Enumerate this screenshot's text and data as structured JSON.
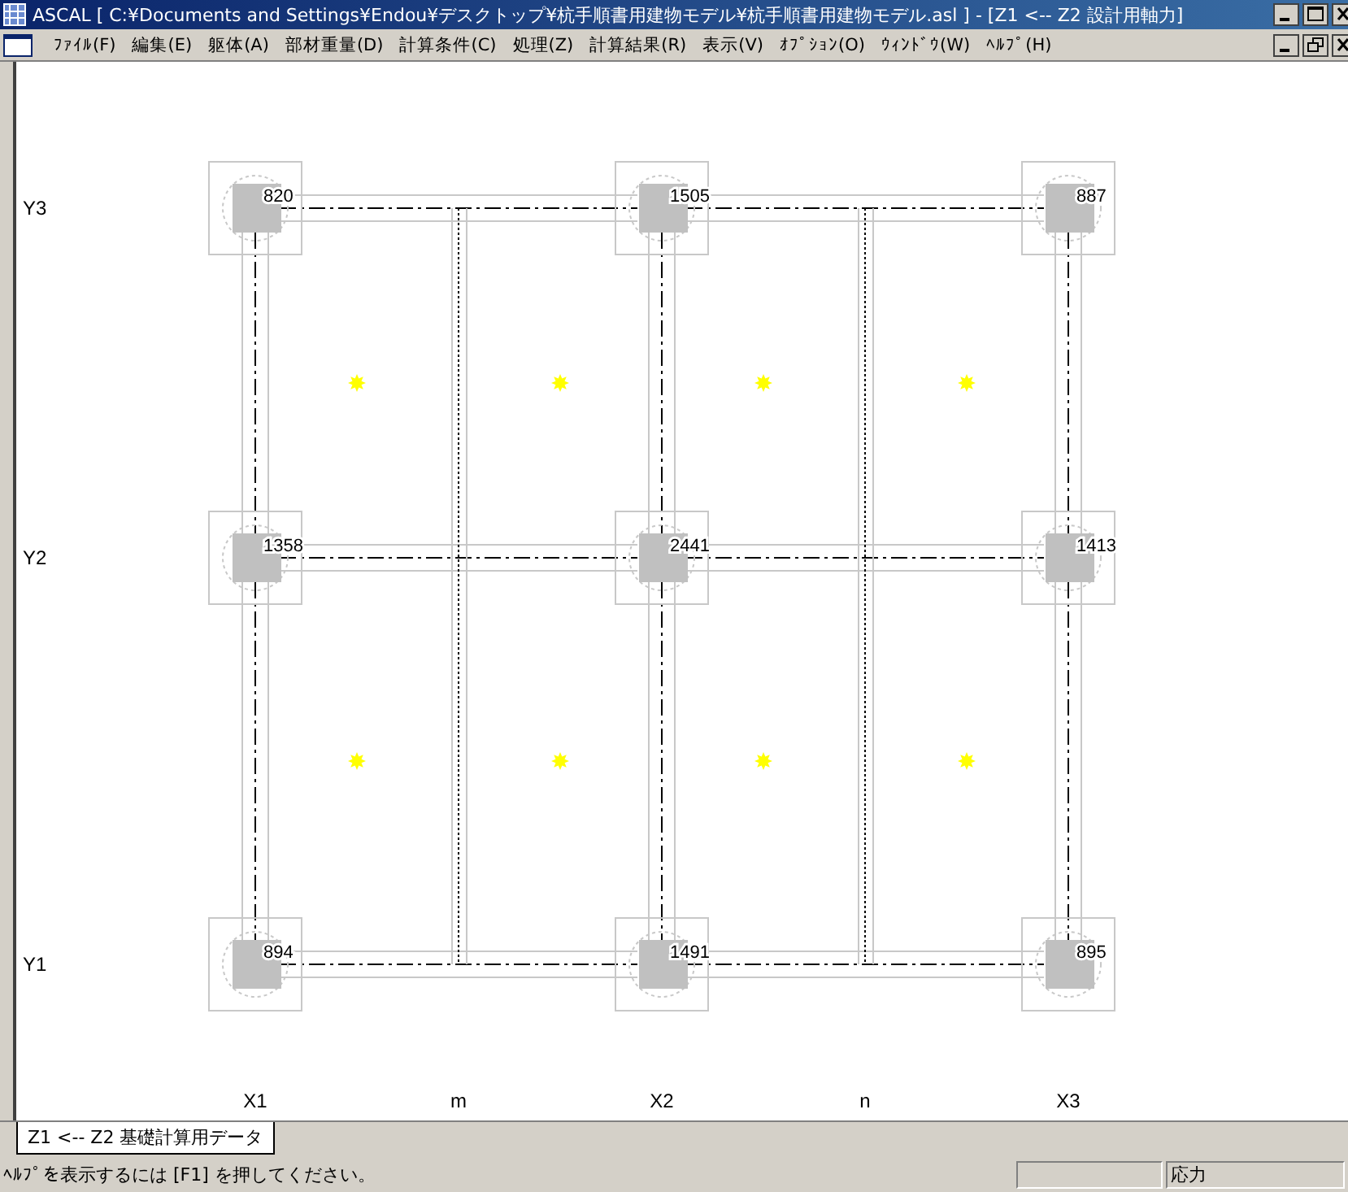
{
  "window": {
    "title": "ASCAL [ C:¥Documents and Settings¥Endou¥デスクトップ¥杭手順書用建物モデル¥杭手順書用建物モデル.asl ] - [Z1 <-- Z2 設計用軸力]"
  },
  "menu": [
    "ﾌｧｲﾙ(F)",
    "編集(E)",
    "躯体(A)",
    "部材重量(D)",
    "計算条件(C)",
    "処理(Z)",
    "計算結果(R)",
    "表示(V)",
    "ｵﾌﾟｼｮﾝ(O)",
    "ｳｨﾝﾄﾞｳ(W)",
    "ﾍﾙﾌﾟ(H)"
  ],
  "plan": {
    "x_axes": [
      {
        "label": "X1",
        "kind": "main"
      },
      {
        "label": "m",
        "kind": "sub"
      },
      {
        "label": "X2",
        "kind": "main"
      },
      {
        "label": "n",
        "kind": "sub"
      },
      {
        "label": "X3",
        "kind": "main"
      }
    ],
    "rows": [
      {
        "axis": "Y3",
        "values": [
          "820",
          "1505",
          "887"
        ]
      },
      {
        "axis": "Y2",
        "values": [
          "1358",
          "2441",
          "1413"
        ]
      },
      {
        "axis": "Y1",
        "values": [
          "894",
          "1491",
          "895"
        ]
      }
    ]
  },
  "tabs": [
    {
      "label": "Z1 <-- Z2 基礎計算用データ",
      "selected": true
    }
  ],
  "status_bar": {
    "text": "ﾍﾙﾌﾟを表示するには [F1] を押してください。",
    "panels": [
      "応力"
    ]
  }
}
